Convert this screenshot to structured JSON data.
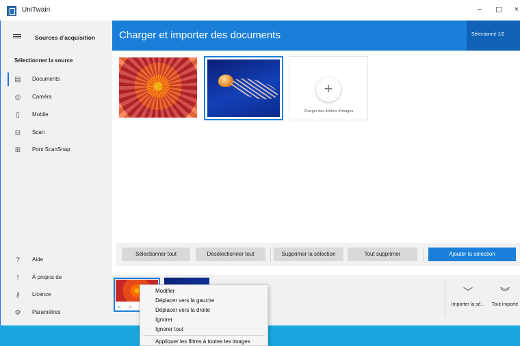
{
  "window": {
    "title": "UniTwain",
    "minimize": "−",
    "maximize": "☐",
    "close": "×"
  },
  "sidebar": {
    "header_label": "Sources d'acquisition",
    "section_title": "Sélectionner la source",
    "sources": [
      {
        "label": "Documents",
        "icon": "document-icon",
        "active": true
      },
      {
        "label": "Caméra",
        "icon": "camera-icon",
        "active": false
      },
      {
        "label": "Mobile",
        "icon": "mobile-icon",
        "active": false
      },
      {
        "label": "Scan",
        "icon": "scanner-icon",
        "active": false
      },
      {
        "label": "Pont ScanSnap",
        "icon": "scansnap-icon",
        "active": false
      }
    ],
    "footer": [
      {
        "label": "Aide",
        "icon": "help-icon"
      },
      {
        "label": "À propos de",
        "icon": "info-icon"
      },
      {
        "label": "Licence",
        "icon": "key-icon"
      },
      {
        "label": "Paramètres",
        "icon": "gear-icon"
      }
    ]
  },
  "header": {
    "title": "Charger et importer des documents",
    "selected_label": "Sélectionné 1/2"
  },
  "content": {
    "add_card_label": "Charger des fichiers d'images"
  },
  "toolbar": {
    "select_all": "Sélectionner tout",
    "deselect_all": "Désélectionner tout",
    "delete_selection": "Supprimer la sélection",
    "delete_all": "Tout supprimer",
    "add_selection": "Ajouter la sélection"
  },
  "strip": {
    "arrow_left": "<",
    "arrow_right": ">",
    "import_selection": "Importer la sé...",
    "import_all": "Tout importe"
  },
  "context_menu": {
    "items": [
      "Modifier",
      "Déplacer vers la gauche",
      "Déplacer vers la droite",
      "Ignorer",
      "Ignorer tout",
      "Appliquer les filtres à toutes les images"
    ]
  },
  "colors": {
    "accent": "#1a7fd8",
    "accent_dark": "#0f62b6",
    "taskbar": "#1aa7e0",
    "sidebar_bg": "#f1f1f1"
  }
}
